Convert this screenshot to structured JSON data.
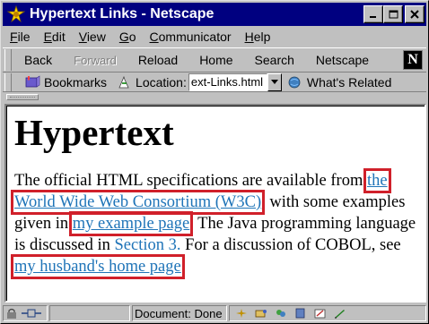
{
  "window": {
    "title": "Hypertext Links - Netscape",
    "buttons": {
      "minimize": "_",
      "maximize": "□",
      "close": "×"
    }
  },
  "menu": {
    "items": [
      {
        "first": "F",
        "rest": "ile"
      },
      {
        "first": "E",
        "rest": "dit"
      },
      {
        "first": "V",
        "rest": "iew"
      },
      {
        "first": "G",
        "rest": "o"
      },
      {
        "first": "C",
        "rest": "ommunicator"
      },
      {
        "first": "H",
        "rest": "elp"
      }
    ]
  },
  "nav": {
    "back": "Back",
    "forward": "Forward",
    "reload": "Reload",
    "home": "Home",
    "search": "Search",
    "netscape": "Netscape",
    "logo": "N"
  },
  "location": {
    "bookmarks": "Bookmarks",
    "label": "Location:",
    "url": "ext-Links.html",
    "related": "What's Related"
  },
  "page": {
    "heading": "Hypertext",
    "t1": "The official HTML specifications are available from ",
    "link_w3c": "the World Wide Web Consortium (W3C)",
    "t2": ", with some examples given in ",
    "link_example": "my example page",
    "t3": ". The Java programming language is discussed in ",
    "link_section": "Section 3.",
    "t4": " For a discussion of COBOL, see ",
    "link_husband": "my husband's home page",
    "t5": "."
  },
  "status": {
    "text": "Document: Done"
  },
  "colors": {
    "titlebar": "#000080",
    "link": "#1f74b8",
    "highlight": "#d0202a"
  }
}
